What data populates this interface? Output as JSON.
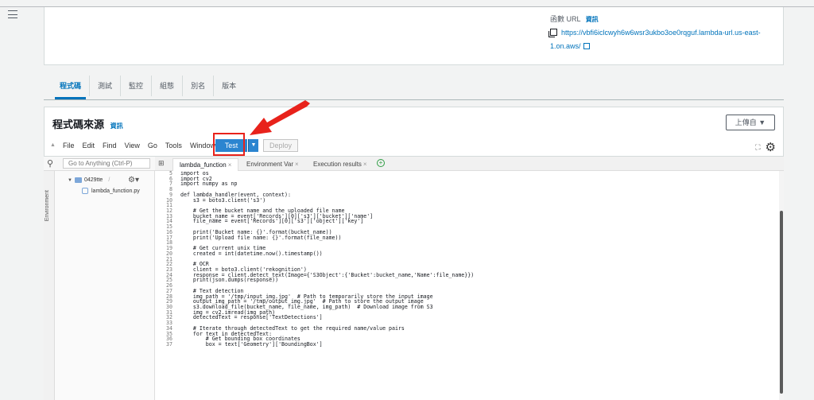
{
  "function_url": {
    "label": "函數 URL",
    "info": "資訊",
    "url_line1": "https://vbfi6iclcwyh6w6wsr3ukbo3oe0rqguf.lambda-url.us-east-",
    "url_line2": "1.on.aws/"
  },
  "tabs": [
    {
      "label": "程式碼",
      "active": true
    },
    {
      "label": "測試",
      "active": false
    },
    {
      "label": "監控",
      "active": false
    },
    {
      "label": "組態",
      "active": false
    },
    {
      "label": "別名",
      "active": false
    },
    {
      "label": "版本",
      "active": false
    }
  ],
  "source": {
    "title": "程式碼來源",
    "info": "資訊",
    "upload_label": "上傳自 ▼"
  },
  "ide_menu": [
    "File",
    "Edit",
    "Find",
    "View",
    "Go",
    "Tools",
    "Window"
  ],
  "buttons": {
    "test": "Test",
    "deploy": "Deploy"
  },
  "search": {
    "placeholder": "Go to Anything (Ctrl-P)"
  },
  "env_label": "Environment",
  "tree": {
    "root": "0429tte",
    "root_suffix": "/",
    "file": "lambda_function.py"
  },
  "editor_tabs": [
    {
      "label": "lambda_function",
      "active": true
    },
    {
      "label": "Environment Var",
      "active": false
    },
    {
      "label": "Execution results",
      "active": false
    }
  ],
  "code_lines": [
    {
      "n": "5",
      "t": "import os"
    },
    {
      "n": "6",
      "t": "import cv2"
    },
    {
      "n": "7",
      "t": "import numpy as np"
    },
    {
      "n": "8",
      "t": ""
    },
    {
      "n": "9",
      "t": "def lambda_handler(event, context):"
    },
    {
      "n": "10",
      "t": "    s3 = boto3.client('s3')"
    },
    {
      "n": "11",
      "t": ""
    },
    {
      "n": "12",
      "t": "    # Get the bucket name and the uploaded file name"
    },
    {
      "n": "13",
      "t": "    bucket_name = event['Records'][0]['s3']['bucket']['name']"
    },
    {
      "n": "14",
      "t": "    file_name = event['Records'][0]['s3']['object']['key']"
    },
    {
      "n": "15",
      "t": ""
    },
    {
      "n": "16",
      "t": "    print('Bucket name: {}'.format(bucket_name))"
    },
    {
      "n": "17",
      "t": "    print('Upload file name: {}'.format(file_name))"
    },
    {
      "n": "18",
      "t": ""
    },
    {
      "n": "19",
      "t": "    # Get current unix time"
    },
    {
      "n": "20",
      "t": "    created = int(datetime.now().timestamp())"
    },
    {
      "n": "21",
      "t": ""
    },
    {
      "n": "22",
      "t": "    # OCR"
    },
    {
      "n": "23",
      "t": "    client = boto3.client('rekognition')"
    },
    {
      "n": "24",
      "t": "    response = client.detect_text(Image={'S3Object':{'Bucket':bucket_name,'Name':file_name}})"
    },
    {
      "n": "25",
      "t": "    print(json.dumps(response))"
    },
    {
      "n": "26",
      "t": ""
    },
    {
      "n": "27",
      "t": "    # Text detection"
    },
    {
      "n": "28",
      "t": "    img_path = '/tmp/input_img.jpg'  # Path to temporarily store the input image"
    },
    {
      "n": "29",
      "t": "    output_img_path = '/tmp/output_img.jpg'  # Path to store the output image"
    },
    {
      "n": "30",
      "t": "    s3.download_file(bucket_name, file_name, img_path)  # Download image from S3"
    },
    {
      "n": "31",
      "t": "    img = cv2.imread(img_path)"
    },
    {
      "n": "32",
      "t": "    detectedText = response['TextDetections']"
    },
    {
      "n": "33",
      "t": ""
    },
    {
      "n": "34",
      "t": "    # Iterate through detectedText to get the required name/value pairs"
    },
    {
      "n": "35",
      "t": "    for text in detectedText:"
    },
    {
      "n": "36",
      "t": "        # Get bounding box coordinates"
    },
    {
      "n": "37",
      "t": "        box = text['Geometry']['BoundingBox']"
    }
  ],
  "colors": {
    "accent": "#0073bb",
    "test_button": "#2b85d0",
    "highlight": "#e8221b"
  }
}
